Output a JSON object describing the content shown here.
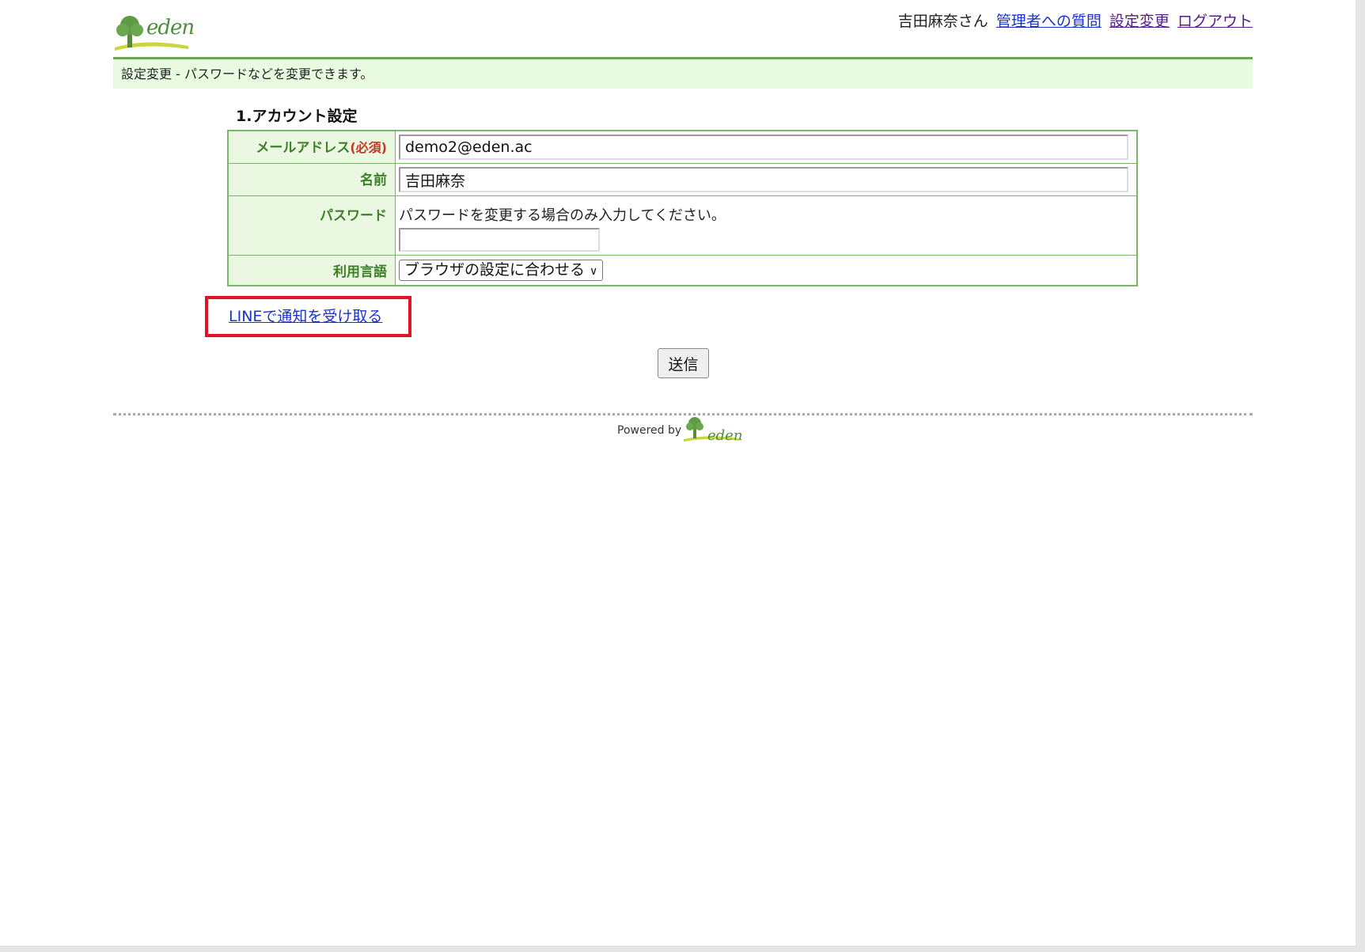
{
  "header": {
    "logo_text": "eden",
    "user_name": "吉田麻奈さん",
    "links": {
      "question": "管理者への質問",
      "settings": "設定変更",
      "logout": "ログアウト"
    },
    "subtitle": "設定変更 - パスワードなどを変更できます。"
  },
  "section": {
    "title": "1.アカウント設定"
  },
  "form": {
    "email_label": "メールアドレス",
    "required_label": "(必須)",
    "email_value": "demo2@eden.ac",
    "name_label": "名前",
    "name_value": "吉田麻奈",
    "password_label": "パスワード",
    "password_hint": "パスワードを変更する場合のみ入力してください。",
    "language_label": "利用言語",
    "language_value": "ブラウザの設定に合わせる"
  },
  "line_link": "LINEで通知を受け取る",
  "submit_label": "送信",
  "footer": {
    "powered_by": "Powered by",
    "logo_text": "eden"
  },
  "colors": {
    "accent": "#6aa84f",
    "highlight": "#e0141e",
    "link": "#1a33cc"
  }
}
